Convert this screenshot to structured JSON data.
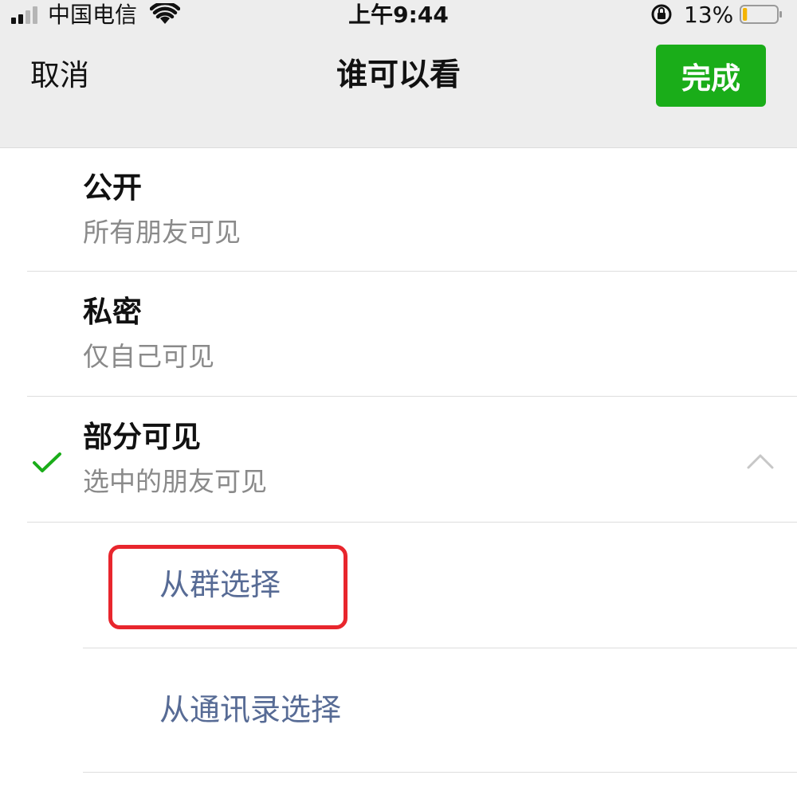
{
  "status_bar": {
    "carrier": "中国电信",
    "time": "上午9:44",
    "battery_percent": "13%",
    "battery_level": 0.13,
    "icons": [
      "signal-icon",
      "wifi-icon",
      "orientation-lock-icon",
      "battery-icon"
    ]
  },
  "nav": {
    "cancel_label": "取消",
    "title": "谁可以看",
    "done_label": "完成"
  },
  "options": [
    {
      "title": "公开",
      "subtitle": "所有朋友可见",
      "selected": false
    },
    {
      "title": "私密",
      "subtitle": "仅自己可见",
      "selected": false
    },
    {
      "title": "部分可见",
      "subtitle": "选中的朋友可见",
      "selected": true,
      "expanded": true
    }
  ],
  "sub_options": [
    {
      "label": "从群选择",
      "highlighted": true
    },
    {
      "label": "从通讯录选择",
      "highlighted": false
    }
  ],
  "colors": {
    "accent_green": "#1aad19",
    "link_blue": "#576b95",
    "highlight_red": "#e8262d"
  }
}
